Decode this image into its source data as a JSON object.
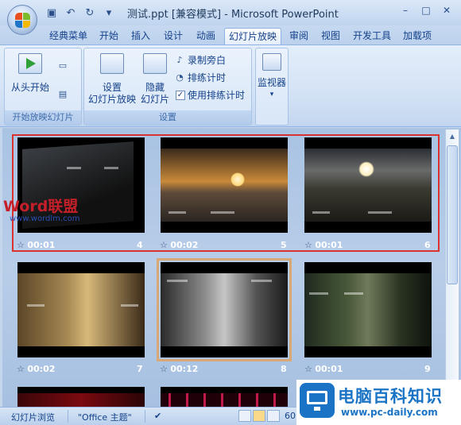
{
  "window": {
    "title": "测试.ppt [兼容模式] - Microsoft PowerPoint",
    "controls": [
      "–",
      "□",
      "✕"
    ]
  },
  "tabs": [
    "经典菜单",
    "开始",
    "插入",
    "设计",
    "动画",
    "幻灯片放映",
    "审阅",
    "视图",
    "开发工具",
    "加载项"
  ],
  "active_tab": "幻灯片放映",
  "ribbon": {
    "start_group": {
      "label": "开始放映幻灯片",
      "from_beginning": "从头开始"
    },
    "setup_group": {
      "label": "设置",
      "setup_show": [
        "设置",
        "幻灯片放映"
      ],
      "hide_slide": [
        "隐藏",
        "幻灯片"
      ],
      "record_narration": "录制旁白",
      "rehearse_timings": "排练计时",
      "use_timings": "使用排练计时",
      "use_timings_checked": true
    },
    "monitors_group": {
      "label": "监视器"
    }
  },
  "slides": [
    {
      "time": "00:01",
      "number": "4"
    },
    {
      "time": "00:02",
      "number": "5"
    },
    {
      "time": "00:01",
      "number": "6"
    },
    {
      "time": "00:02",
      "number": "7"
    },
    {
      "time": "00:12",
      "number": "8"
    },
    {
      "time": "00:01",
      "number": "9"
    }
  ],
  "watermark": {
    "word": "Word联盟",
    "url": "www.wordlm.com"
  },
  "statusbar": {
    "view": "幻灯片浏览",
    "theme": "\"Office 主题\"",
    "zoom": "60"
  },
  "site_logo": {
    "name": "电脑百科知识",
    "url": "www.pc-daily.com"
  }
}
